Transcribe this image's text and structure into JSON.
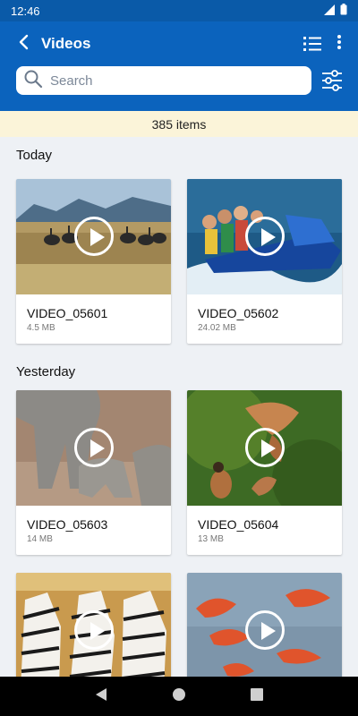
{
  "status": {
    "time": "12:46"
  },
  "app_bar": {
    "title": "Videos"
  },
  "search": {
    "placeholder": "Search"
  },
  "count": {
    "label": "385 items"
  },
  "sections": [
    {
      "title": "Today"
    },
    {
      "title": "Yesterday"
    }
  ],
  "videos": [
    {
      "name": "VIDEO_05601",
      "size": "4.5 MB"
    },
    {
      "name": "VIDEO_05602",
      "size": "24.02 MB"
    },
    {
      "name": "VIDEO_05603",
      "size": "14 MB"
    },
    {
      "name": "VIDEO_05604",
      "size": "13 MB"
    },
    {
      "name": "",
      "size": ""
    },
    {
      "name": "",
      "size": ""
    }
  ],
  "icons": {
    "back": "back-arrow-icon",
    "list": "list-view-icon",
    "more": "more-vert-icon",
    "search": "search-icon",
    "filter": "filter-sliders-icon",
    "play": "play-icon"
  },
  "colors": {
    "app_bar": "#0b63bd",
    "status_bar": "#0a5aa8",
    "count_bar": "#fbf4d9",
    "background": "#eef1f5"
  }
}
